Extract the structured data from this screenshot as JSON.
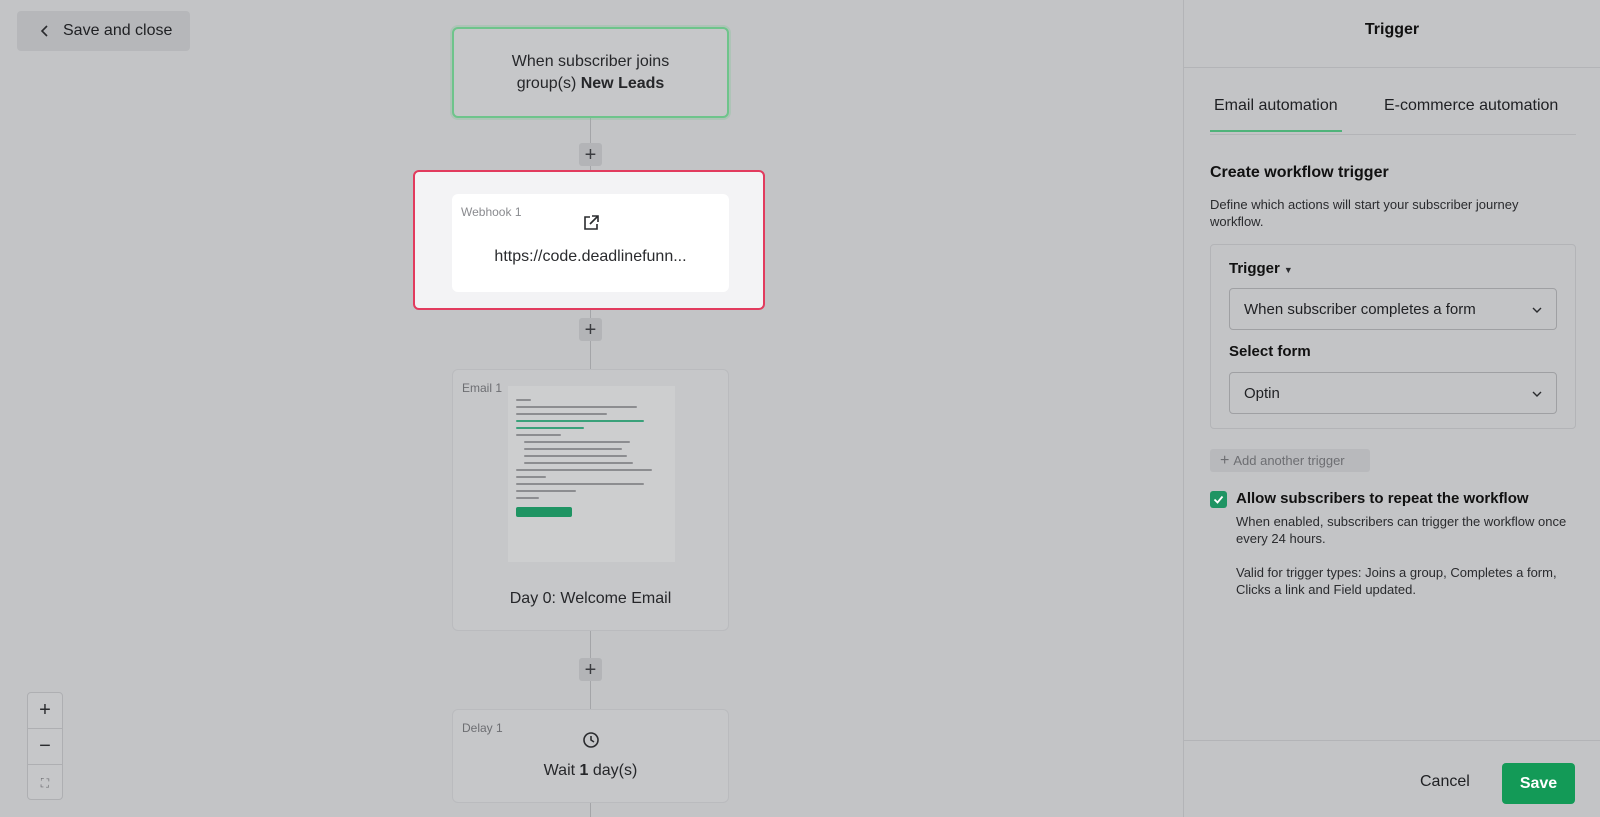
{
  "header": {
    "save_close_label": "Save and close"
  },
  "workflow": {
    "trigger_node": {
      "text": "When subscriber joins group(s)",
      "group": "New Leads"
    },
    "webhook_node": {
      "label": "Webhook 1",
      "url": "https://code.deadlinefunn..."
    },
    "email_node": {
      "label": "Email 1",
      "title": "Day 0: Welcome Email"
    },
    "delay_node": {
      "label": "Delay 1",
      "prefix": "Wait",
      "amount": "1",
      "suffix": "day(s)"
    },
    "add_step_symbol": "+"
  },
  "zoom": {
    "in": "+",
    "out": "−",
    "fit": "⛶"
  },
  "panel": {
    "title": "Trigger",
    "tabs": [
      "Email automation",
      "E-commerce automation"
    ],
    "active_tab": "Email automation",
    "section_title": "Create workflow trigger",
    "section_desc": "Define which actions will start your subscriber journey workflow.",
    "trigger_label": "Trigger",
    "trigger_value": "When subscriber completes a form",
    "form_label": "Select form",
    "form_value": "Optin",
    "add_trigger_label": "Add another trigger",
    "repeat_label": "Allow subscribers to repeat the workflow",
    "repeat_checked": true,
    "repeat_desc": "When enabled, subscribers can trigger the workflow once every 24 hours.",
    "repeat_note": "Valid for trigger types: Joins a group, Completes a form, Clicks a link and Field updated.",
    "cancel_label": "Cancel",
    "save_label": "Save"
  },
  "colors": {
    "accent_green": "#139a57",
    "selected_border": "#e23b5e",
    "trigger_border": "#6ec48b"
  }
}
